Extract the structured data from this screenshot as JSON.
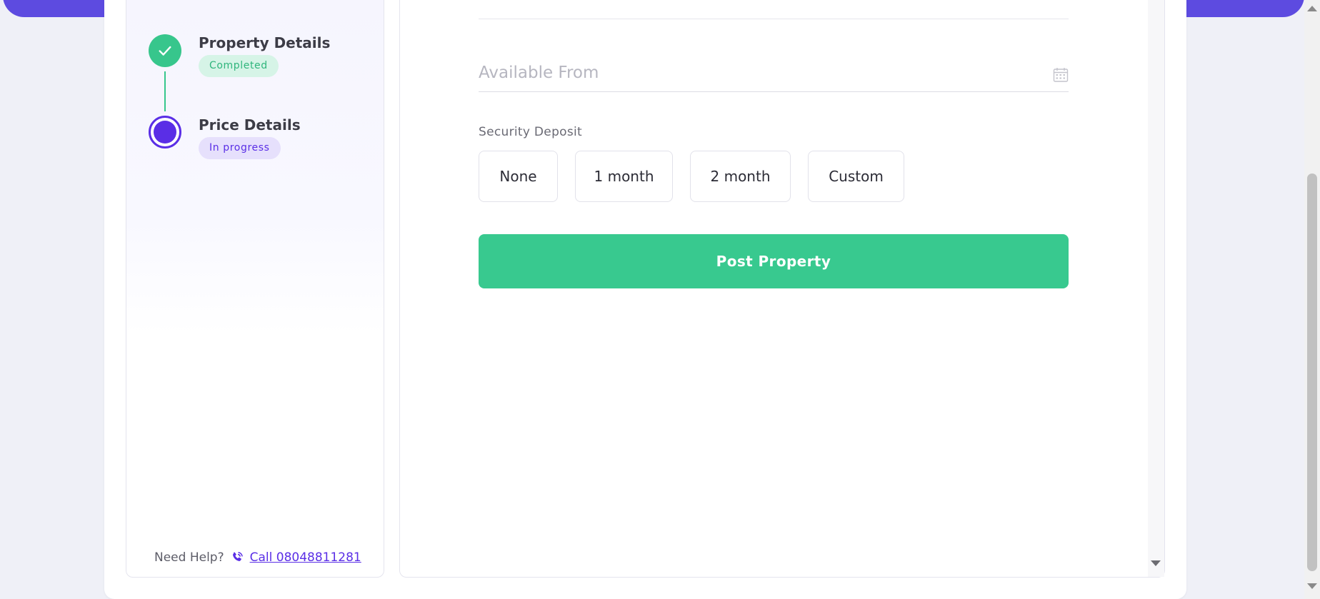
{
  "steps": [
    {
      "title": "Property Details",
      "status": "Completed"
    },
    {
      "title": "Price Details",
      "status": "In progress"
    }
  ],
  "help": {
    "prompt": "Need Help?",
    "call_link": "Call 08048811281"
  },
  "form": {
    "available_from": {
      "placeholder": "Available From",
      "value": ""
    },
    "security_deposit": {
      "label": "Security Deposit",
      "options": [
        "None",
        "1 month",
        "2 month",
        "Custom"
      ]
    },
    "submit_label": "Post Property"
  },
  "colors": {
    "brand_purple": "#5d4be0",
    "accent_purple": "#5a2ee6",
    "success_green": "#38c98f"
  },
  "icons": {
    "step_completed": "check-icon",
    "help": "phone-icon",
    "date_picker": "calendar-icon"
  }
}
